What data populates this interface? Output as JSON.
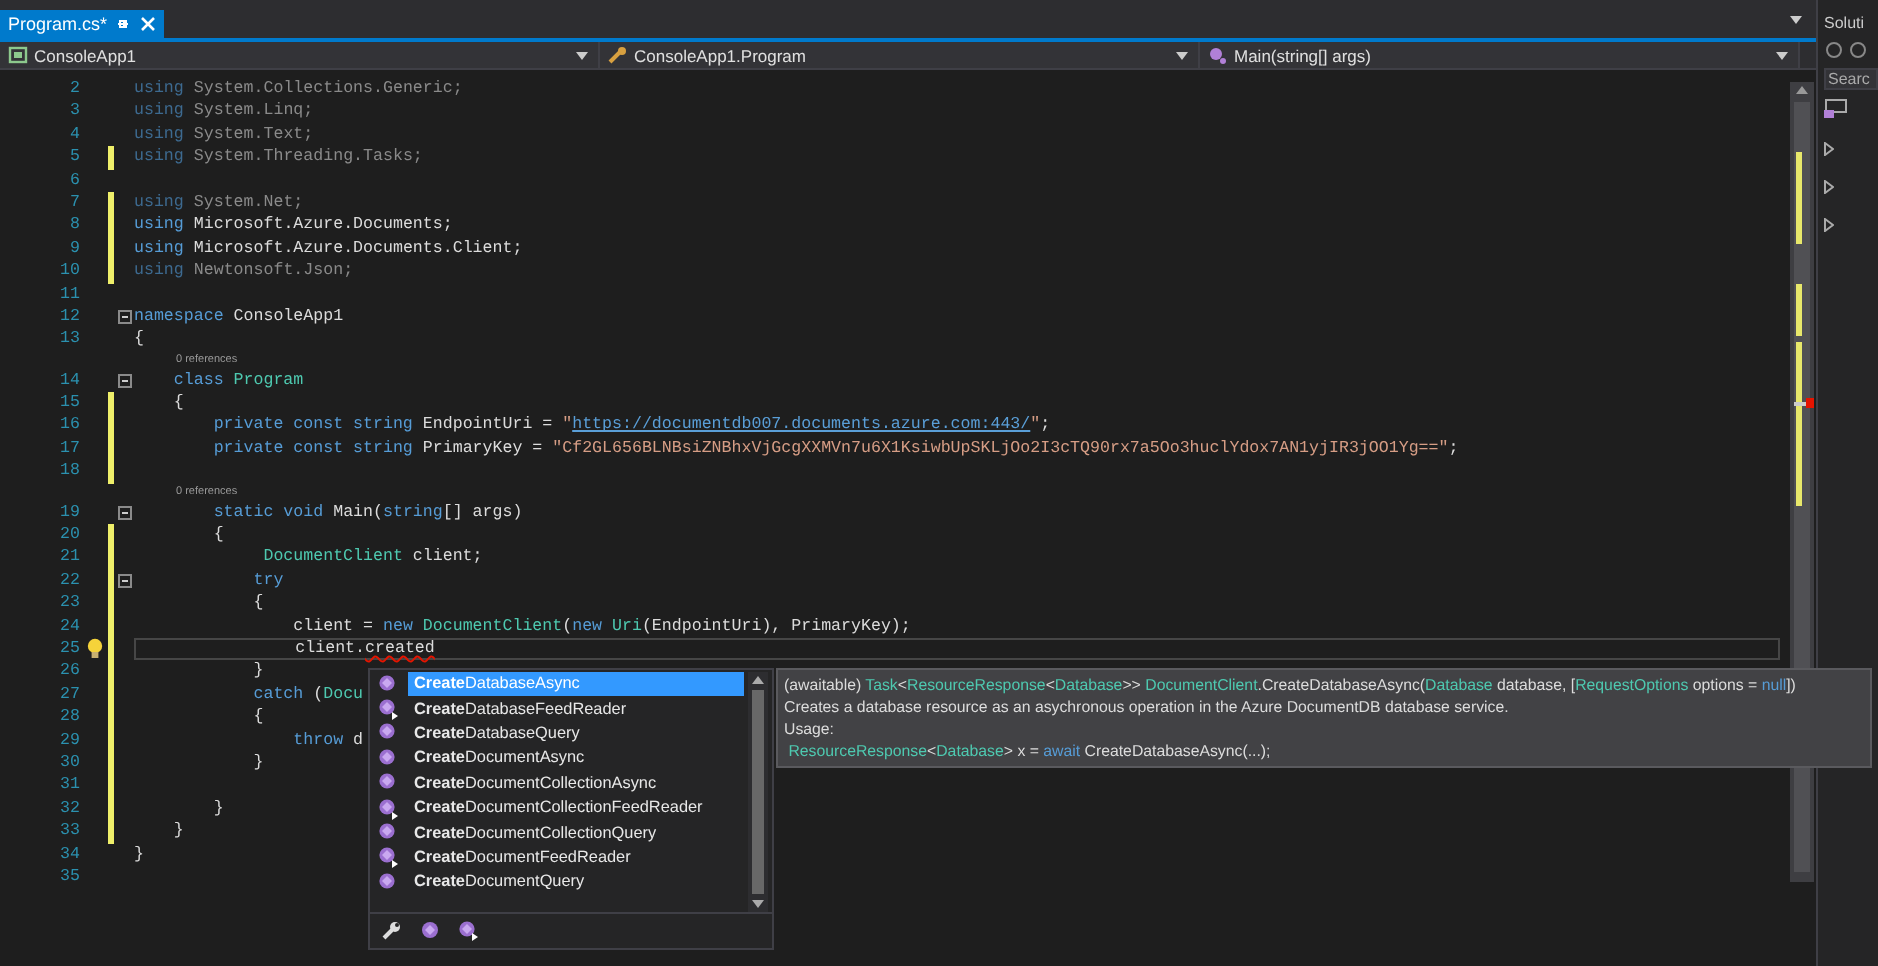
{
  "tab": {
    "title": "Program.cs*",
    "selected": true
  },
  "navigation": [
    {
      "kind": "project",
      "label": "ConsoleApp1"
    },
    {
      "kind": "class",
      "label": "ConsoleApp1.Program"
    },
    {
      "kind": "method",
      "label": "Main(string[] args)"
    }
  ],
  "lines": [
    {
      "number": "2",
      "changed": false,
      "fold": false,
      "current": false,
      "lightbulb": false,
      "tokens": [
        {
          "kind": "dimkw",
          "text": "using"
        },
        {
          "kind": "dim",
          "text": " System.Collections.Generic;"
        }
      ]
    },
    {
      "number": "3",
      "changed": false,
      "fold": false,
      "current": false,
      "lightbulb": false,
      "tokens": [
        {
          "kind": "dimkw",
          "text": "using"
        },
        {
          "kind": "dim",
          "text": " System.Linq;"
        }
      ]
    },
    {
      "number": "4",
      "changed": false,
      "fold": false,
      "current": false,
      "lightbulb": false,
      "tokens": [
        {
          "kind": "dimkw",
          "text": "using"
        },
        {
          "kind": "dim",
          "text": " System.Text;"
        }
      ]
    },
    {
      "number": "5",
      "changed": true,
      "fold": false,
      "current": false,
      "lightbulb": false,
      "tokens": [
        {
          "kind": "dimkw",
          "text": "using"
        },
        {
          "kind": "dim",
          "text": " System.Threading.Tasks;"
        }
      ]
    },
    {
      "number": "6",
      "changed": false,
      "fold": false,
      "current": false,
      "lightbulb": false
    },
    {
      "number": "7",
      "changed": true,
      "fold": false,
      "current": false,
      "lightbulb": false,
      "tokens": [
        {
          "kind": "dimkw",
          "text": "using"
        },
        {
          "kind": "dim",
          "text": " System.Net;"
        }
      ]
    },
    {
      "number": "8",
      "changed": true,
      "fold": false,
      "current": false,
      "lightbulb": false,
      "tokens": [
        {
          "kind": "kw",
          "text": "using"
        },
        {
          "kind": "text",
          "text": " Microsoft.Azure.Documents;"
        }
      ]
    },
    {
      "number": "9",
      "changed": true,
      "fold": false,
      "current": false,
      "lightbulb": false,
      "tokens": [
        {
          "kind": "kw",
          "text": "using"
        },
        {
          "kind": "text",
          "text": " Microsoft.Azure.Documents.Client;"
        }
      ]
    },
    {
      "number": "10",
      "changed": true,
      "fold": false,
      "current": false,
      "lightbulb": false,
      "tokens": [
        {
          "kind": "dimkw",
          "text": "using"
        },
        {
          "kind": "dim",
          "text": " Newtonsoft.Json;"
        }
      ]
    },
    {
      "number": "11",
      "changed": false,
      "fold": false,
      "current": false,
      "lightbulb": false
    },
    {
      "number": "12",
      "changed": false,
      "fold": true,
      "current": false,
      "lightbulb": false,
      "tokens": [
        {
          "kind": "kw",
          "text": "namespace"
        },
        {
          "kind": "text",
          "text": " ConsoleApp1"
        }
      ]
    },
    {
      "number": "13",
      "changed": false,
      "fold": false,
      "current": false,
      "lightbulb": false,
      "tokens": [
        {
          "kind": "text",
          "text": "{"
        }
      ]
    },
    {
      "number": "14",
      "lens": "0 references",
      "changed": false,
      "fold": true,
      "current": false,
      "lightbulb": false,
      "tokens": [
        {
          "kind": "kw",
          "text": "    class"
        },
        {
          "kind": "type",
          "text": " Program"
        }
      ]
    },
    {
      "number": "15",
      "changed": true,
      "fold": false,
      "current": false,
      "lightbulb": false,
      "tokens": [
        {
          "kind": "text",
          "text": "    {"
        }
      ]
    },
    {
      "number": "16",
      "changed": true,
      "fold": false,
      "current": false,
      "lightbulb": false,
      "tokens": [
        {
          "kind": "kw",
          "text": "        private const string"
        },
        {
          "kind": "text",
          "text": " EndpointUri = "
        },
        {
          "kind": "str",
          "text": "\""
        },
        {
          "kind": "url",
          "text": "https://documentdb007.documents.azure.com:443/"
        },
        {
          "kind": "str",
          "text": "\""
        },
        {
          "kind": "text",
          "text": ";"
        }
      ]
    },
    {
      "number": "17",
      "changed": true,
      "fold": false,
      "current": false,
      "lightbulb": false,
      "tokens": [
        {
          "kind": "kw",
          "text": "        private const string"
        },
        {
          "kind": "text",
          "text": " PrimaryKey = "
        },
        {
          "kind": "str",
          "text": "\"Cf2GL656BLNBsiZNBhxVjGcgXXMVn7u6X1KsiwbUpSKLjOo2I3cTQ90rx7a5Oo3huclYdox7AN1yjIR3jOO1Yg==\""
        },
        {
          "kind": "text",
          "text": ";"
        }
      ]
    },
    {
      "number": "18",
      "changed": true,
      "fold": false,
      "current": false,
      "lightbulb": false
    },
    {
      "number": "19",
      "lens": "0 references",
      "changed": false,
      "fold": true,
      "current": false,
      "lightbulb": false,
      "tokens": [
        {
          "kind": "kw",
          "text": "        static void"
        },
        {
          "kind": "text",
          "text": " Main("
        },
        {
          "kind": "kw",
          "text": "string"
        },
        {
          "kind": "text",
          "text": "[] args)"
        }
      ]
    },
    {
      "number": "20",
      "changed": true,
      "fold": false,
      "current": false,
      "lightbulb": false,
      "tokens": [
        {
          "kind": "text",
          "text": "        {"
        }
      ]
    },
    {
      "number": "21",
      "changed": true,
      "fold": false,
      "current": false,
      "lightbulb": false,
      "tokens": [
        {
          "kind": "type",
          "text": "             DocumentClient"
        },
        {
          "kind": "text",
          "text": " client;"
        }
      ]
    },
    {
      "number": "22",
      "changed": true,
      "fold": true,
      "current": false,
      "lightbulb": false,
      "tokens": [
        {
          "kind": "kw",
          "text": "            try"
        }
      ]
    },
    {
      "number": "23",
      "changed": true,
      "fold": false,
      "current": false,
      "lightbulb": false,
      "tokens": [
        {
          "kind": "text",
          "text": "            {"
        }
      ]
    },
    {
      "number": "24",
      "changed": true,
      "fold": false,
      "current": false,
      "lightbulb": false,
      "tokens": [
        {
          "kind": "text",
          "text": "                client = "
        },
        {
          "kind": "kw",
          "text": "new"
        },
        {
          "kind": "type",
          "text": " DocumentClient"
        },
        {
          "kind": "text",
          "text": "("
        },
        {
          "kind": "kw",
          "text": "new"
        },
        {
          "kind": "type",
          "text": " Uri"
        },
        {
          "kind": "text",
          "text": "(EndpointUri), PrimaryKey);"
        }
      ]
    },
    {
      "number": "25",
      "changed": true,
      "fold": false,
      "current": true,
      "lightbulb": true,
      "tokens": [
        {
          "kind": "text",
          "text": "                client."
        },
        {
          "kind": "err",
          "text": "created"
        }
      ]
    },
    {
      "number": "26",
      "changed": true,
      "fold": false,
      "current": false,
      "lightbulb": false,
      "tokens": [
        {
          "kind": "text",
          "text": "            }"
        }
      ]
    },
    {
      "number": "27",
      "changed": true,
      "fold": false,
      "current": false,
      "lightbulb": false,
      "tokens": [
        {
          "kind": "kw",
          "text": "            catch"
        },
        {
          "kind": "text",
          "text": " ("
        },
        {
          "kind": "type",
          "text": "Docu"
        }
      ]
    },
    {
      "number": "28",
      "changed": true,
      "fold": false,
      "current": false,
      "lightbulb": false,
      "tokens": [
        {
          "kind": "text",
          "text": "            {"
        }
      ]
    },
    {
      "number": "29",
      "changed": true,
      "fold": false,
      "current": false,
      "lightbulb": false,
      "tokens": [
        {
          "kind": "kw",
          "text": "                throw"
        },
        {
          "kind": "text",
          "text": " d"
        }
      ]
    },
    {
      "number": "30",
      "changed": true,
      "fold": false,
      "current": false,
      "lightbulb": false,
      "tokens": [
        {
          "kind": "text",
          "text": "            }"
        }
      ]
    },
    {
      "number": "31",
      "changed": true,
      "fold": false,
      "current": false,
      "lightbulb": false
    },
    {
      "number": "32",
      "changed": true,
      "fold": false,
      "current": false,
      "lightbulb": false,
      "tokens": [
        {
          "kind": "text",
          "text": "        }"
        }
      ]
    },
    {
      "number": "33",
      "changed": true,
      "fold": false,
      "current": false,
      "lightbulb": false,
      "tokens": [
        {
          "kind": "text",
          "text": "    }"
        }
      ]
    },
    {
      "number": "34",
      "changed": false,
      "fold": false,
      "current": false,
      "lightbulb": false,
      "tokens": [
        {
          "kind": "text",
          "text": "}"
        }
      ]
    },
    {
      "number": "35",
      "changed": false,
      "fold": false,
      "current": false,
      "lightbulb": false
    }
  ],
  "completion": {
    "items": [
      {
        "label": "**Create**DatabaseAsync",
        "kind": "method",
        "selected": true
      },
      {
        "label": "**Create**DatabaseFeedReader",
        "kind": "extension",
        "selected": false
      },
      {
        "label": "**Create**DatabaseQuery",
        "kind": "method",
        "selected": false
      },
      {
        "label": "**Create**DocumentAsync",
        "kind": "method",
        "selected": false
      },
      {
        "label": "**Create**DocumentCollectionAsync",
        "kind": "method",
        "selected": false
      },
      {
        "label": "**Create**DocumentCollectionFeedReader",
        "kind": "extension",
        "selected": false
      },
      {
        "label": "**Create**DocumentCollectionQuery",
        "kind": "method",
        "selected": false
      },
      {
        "label": "**Create**DocumentFeedReader",
        "kind": "extension",
        "selected": false
      },
      {
        "label": "**Create**DocumentQuery",
        "kind": "method",
        "selected": false
      }
    ],
    "filters": [
      {
        "kind": "wrench"
      },
      {
        "kind": "method"
      },
      {
        "kind": "extension"
      }
    ]
  },
  "tooltip": {
    "lines": [
      [
        {
          "kind": "text",
          "text": "(awaitable) "
        },
        {
          "kind": "type",
          "text": "Task"
        },
        {
          "kind": "text",
          "text": "<"
        },
        {
          "kind": "type",
          "text": "ResourceResponse"
        },
        {
          "kind": "text",
          "text": "<"
        },
        {
          "kind": "type",
          "text": "Database"
        },
        {
          "kind": "text",
          "text": ">> "
        },
        {
          "kind": "type",
          "text": "DocumentClient"
        },
        {
          "kind": "text",
          "text": ".CreateDatabaseAsync("
        },
        {
          "kind": "type",
          "text": "Database"
        },
        {
          "kind": "text",
          "text": " database, ["
        },
        {
          "kind": "type",
          "text": "RequestOptions"
        },
        {
          "kind": "text",
          "text": " options = "
        },
        {
          "kind": "kw",
          "text": "null"
        },
        {
          "kind": "text",
          "text": "])"
        }
      ],
      [
        {
          "kind": "text",
          "text": "Creates a database resource as an asychronous operation in the Azure DocumentDB database service."
        }
      ],
      [
        {
          "kind": "text",
          "text": "Usage:"
        }
      ],
      [
        {
          "kind": "type",
          "text": " ResourceResponse"
        },
        {
          "kind": "text",
          "text": "<"
        },
        {
          "kind": "type",
          "text": "Database"
        },
        {
          "kind": "text",
          "text": "> x = "
        },
        {
          "kind": "kw",
          "text": "await"
        },
        {
          "kind": "text",
          "text": " CreateDatabaseAsync(...);"
        }
      ]
    ]
  },
  "side_panel": {
    "title": "Soluti",
    "search": {
      "placeholder": "Searc"
    }
  }
}
